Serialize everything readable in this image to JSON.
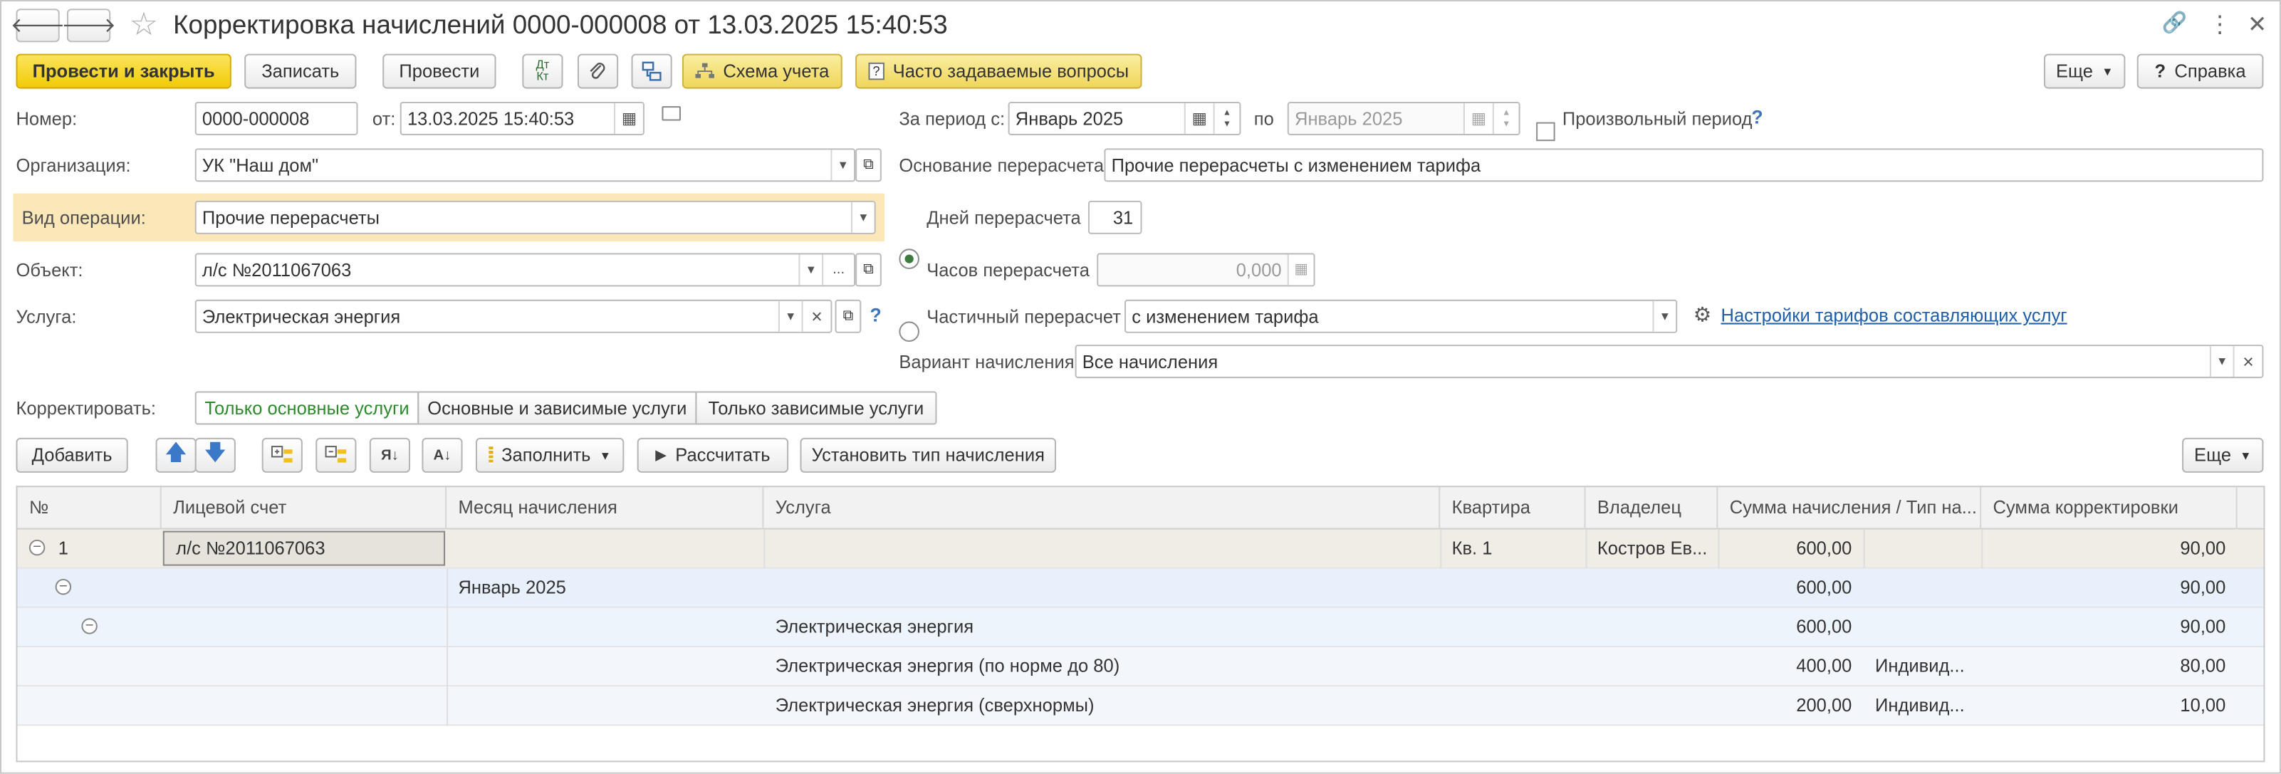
{
  "window": {
    "title": "Корректировка начислений 0000-000008 от 13.03.2025 15:40:53",
    "nav_back": "🡐",
    "nav_forward": "🡒",
    "star": "☆",
    "link_icon": "🔗",
    "menu_icon": "⋮",
    "close_icon": "✕"
  },
  "toolbar": {
    "post_and_close": "Провести и закрыть",
    "save": "Записать",
    "post": "Провести",
    "dtkt_top": "Дт",
    "dtkt_bottom": "Кт",
    "scheme": "Схема учета",
    "faq": "Часто задаваемые вопросы",
    "more": "Еще",
    "help": "Справка",
    "help_q": "?"
  },
  "form": {
    "number_label": "Номер:",
    "number_value": "0000-000008",
    "from_label": "от:",
    "date_value": "13.03.2025 15:40:53",
    "period_label": "За период с:",
    "period_from": "Январь 2025",
    "period_to_label": "по",
    "period_to": "Январь 2025",
    "arbitrary_period": "Произвольный период",
    "question": "?",
    "org_label": "Организация:",
    "org_value": "УК \"Наш дом\"",
    "recalc_basis_label": "Основание перерасчета:",
    "recalc_basis_value": "Прочие перерасчеты с изменением тарифа",
    "op_type_label": "Вид операции:",
    "op_type_value": "Прочие перерасчеты",
    "days_label": "Дней перерасчета",
    "days_value": "31",
    "object_label": "Объект:",
    "object_value": "л/с №2011067063",
    "hours_label": "Часов перерасчета",
    "hours_value": "0,000",
    "service_label": "Услуга:",
    "service_value": "Электрическая энергия",
    "partial_label": "Частичный перерасчет",
    "partial_value": "с изменением тарифа",
    "tariff_link": "Настройки тарифов составляющих услуг",
    "variant_label": "Вариант начисления:",
    "variant_value": "Все начисления",
    "correct_label": "Корректировать:",
    "correct_options": [
      "Только основные услуги",
      "Основные и зависимые услуги",
      "Только зависимые услуги"
    ],
    "correct_selected": "Только основные услуги",
    "dots": "...",
    "clear_x": "×"
  },
  "table_toolbar": {
    "add": "Добавить",
    "up": "🡅",
    "down": "🡇",
    "fill": "Заполнить",
    "calculate": "Рассчитать",
    "set_type": "Установить тип начисления",
    "more": "Еще"
  },
  "table": {
    "columns": [
      "№",
      "Лицевой счет",
      "Месяц начисления",
      "Услуга",
      "Квартира",
      "Владелец",
      "Сумма начисления / Тип на...",
      "Сумма корректировки"
    ],
    "rows": [
      {
        "num": "1",
        "account": "л/с №2011067063",
        "month": "",
        "service": "",
        "apt": "Кв. 1",
        "owner": "Костров Ев...",
        "sum": "600,00",
        "type": "",
        "corr": "90,00"
      },
      {
        "num": "",
        "account": "",
        "month": "Январь 2025",
        "service": "",
        "apt": "",
        "owner": "",
        "sum": "600,00",
        "type": "",
        "corr": "90,00"
      },
      {
        "num": "",
        "account": "",
        "month": "",
        "service": "Электрическая энергия",
        "apt": "",
        "owner": "",
        "sum": "600,00",
        "type": "",
        "corr": "90,00"
      },
      {
        "num": "",
        "account": "",
        "month": "",
        "service": "Электрическая энергия (по норме до 80)",
        "apt": "",
        "owner": "",
        "sum": "400,00",
        "type": "Индивид...",
        "corr": "80,00"
      },
      {
        "num": "",
        "account": "",
        "month": "",
        "service": "Электрическая энергия (сверхнормы)",
        "apt": "",
        "owner": "",
        "sum": "200,00",
        "type": "Индивид...",
        "corr": "10,00"
      }
    ]
  }
}
